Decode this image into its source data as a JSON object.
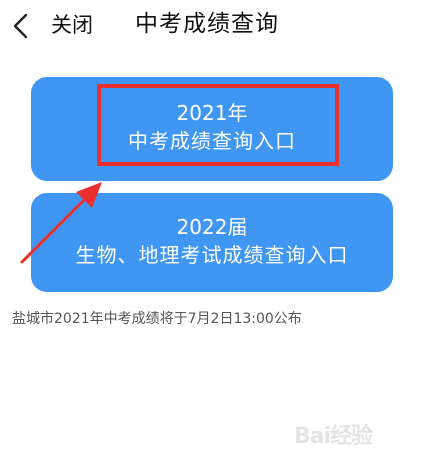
{
  "header": {
    "back_icon": "chevron-left-icon",
    "close_label": "关闭",
    "title": "中考成绩查询"
  },
  "entries": [
    {
      "line1": "2021年",
      "line2": "中考成绩查询入口"
    },
    {
      "line1": "2022届",
      "line2": "生物、地理考试成绩查询入口"
    }
  ],
  "note": "盐城市2021年中考成绩将于7月2日13:00公布",
  "watermark": {
    "text": "Bai经验",
    "icon": "paw-icon"
  },
  "colors": {
    "button_blue": "#3f96f3",
    "annotation_red": "#ea2f2f"
  }
}
